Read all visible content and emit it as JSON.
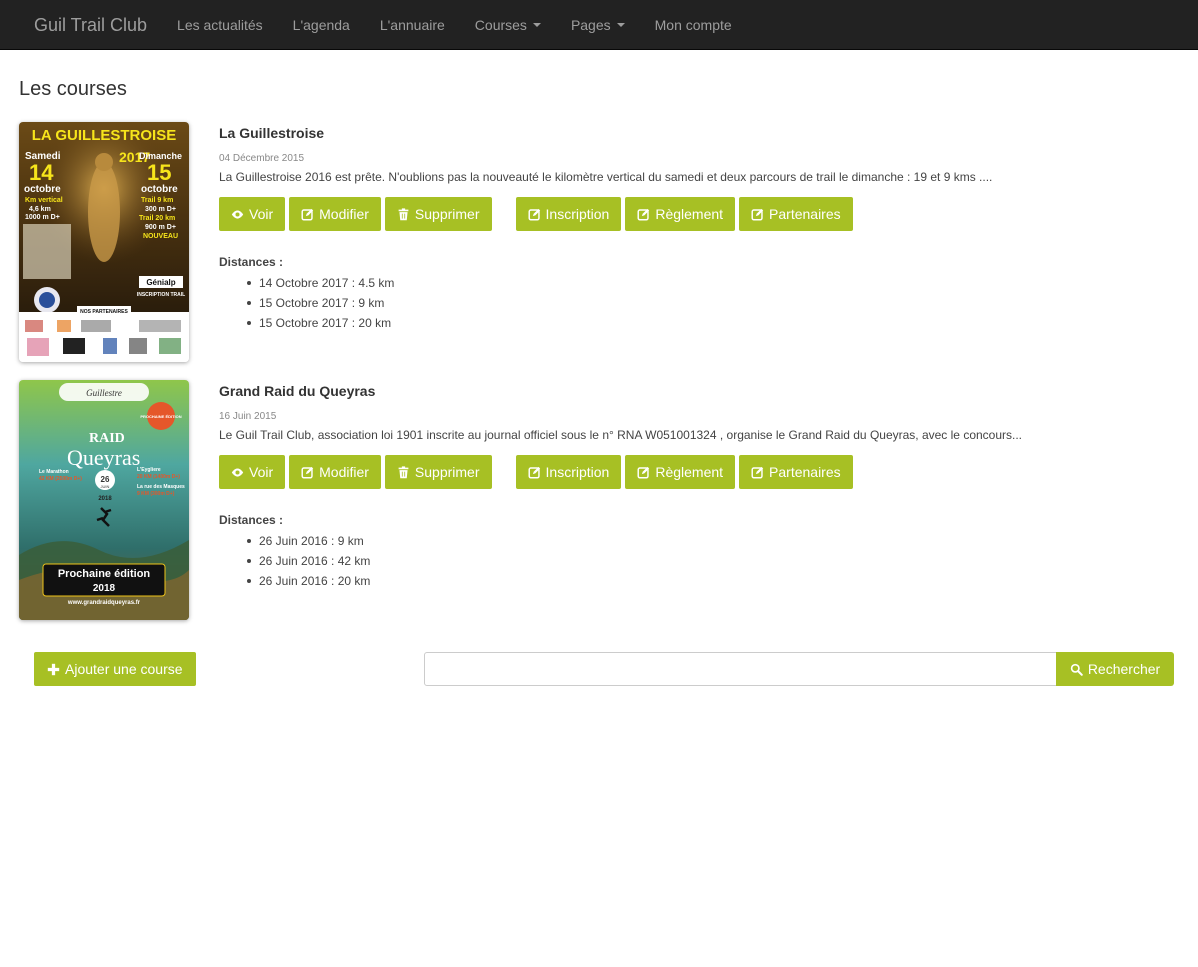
{
  "nav": {
    "brand": "Guil Trail Club",
    "items": [
      {
        "label": "Les actualités",
        "dropdown": false
      },
      {
        "label": "L'agenda",
        "dropdown": false
      },
      {
        "label": "L'annuaire",
        "dropdown": false
      },
      {
        "label": "Courses",
        "dropdown": true
      },
      {
        "label": "Pages",
        "dropdown": true
      },
      {
        "label": "Mon compte",
        "dropdown": false
      }
    ]
  },
  "page": {
    "title": "Les courses"
  },
  "colors": {
    "accent": "#a7c024",
    "navbar": "#222222",
    "nav_text": "#9d9d9d"
  },
  "buttons": {
    "view": "Voir",
    "edit": "Modifier",
    "delete": "Supprimer",
    "register": "Inscription",
    "rules": "Règlement",
    "partners": "Partenaires"
  },
  "distances_label": "Distances :",
  "races": [
    {
      "title": "La Guillestroise",
      "date": "04 Décembre 2015",
      "description": "La Guillestroise 2016 est prête. N'oublions pas la nouveauté le kilomètre vertical du samedi et deux parcours de trail le dimanche : 19 et 9 kms ....",
      "poster": {
        "title": "LA GUILLESTROISE",
        "year": "2017",
        "left_day": "Samedi",
        "left_num": "14",
        "left_month": "octobre",
        "left_info1": "Km vertical",
        "left_info2": "4,6 km",
        "left_info3": "1000 m D+",
        "right_day": "Dimanche",
        "right_num": "15",
        "right_month": "octobre",
        "right_info1": "Trail 9 km",
        "right_info2": "300 m D+",
        "right_info3": "Trail 20 km",
        "right_info4": "900 m D+",
        "right_info5": "NOUVEAU",
        "sponsor": "Génialp",
        "inscription": "INSCRIPTION TRAIL",
        "partners": "NOS PARTENAIRES"
      },
      "distances": [
        "14 Octobre 2017 : 4.5 km",
        "15 Octobre 2017 : 9 km",
        "15 Octobre 2017 : 20 km"
      ]
    },
    {
      "title": "Grand Raid du Queyras",
      "date": "16 Juin 2015",
      "description": "Le Guil Trail Club, association loi 1901 inscrite au journal officiel sous le n° RNA W051001324 , organise le Grand Raid du Queyras, avec le concours...",
      "poster": {
        "logo": "Guillestre",
        "title1": "RAID",
        "title2": "Queyras",
        "day": "26",
        "month": "JUIN",
        "year": "2018",
        "left_info1": "Le Marathon",
        "left_info2": "42 KM (2500m D+)",
        "right_info1": "L'Eygliere",
        "right_info2": "20 KM (1400m D+)",
        "right_info3": "La rue des Masques",
        "right_info4": "9 KM (300m D+)",
        "badge": "PROCHAINE ÉDITION",
        "next_label": "Prochaine édition",
        "next_year": "2018",
        "url": "www.grandraidqueyras.fr"
      },
      "distances": [
        "26 Juin 2016 : 9 km",
        "26 Juin 2016 : 42 km",
        "26 Juin 2016 : 20 km"
      ]
    }
  ],
  "bottom": {
    "add_label": "Ajouter une course",
    "search_value": "",
    "search_placeholder": "",
    "search_label": "Rechercher"
  }
}
